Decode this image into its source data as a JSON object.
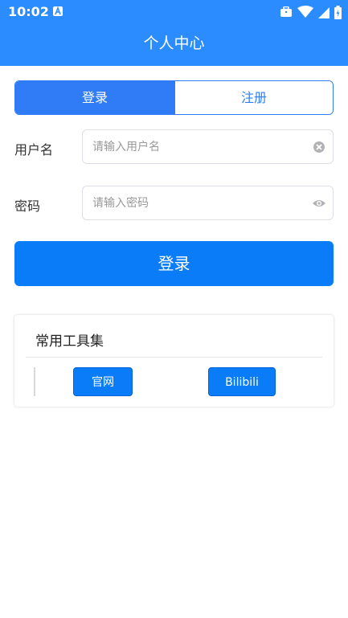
{
  "status_bar": {
    "time": "10:02"
  },
  "header": {
    "title": "个人中心"
  },
  "tabs": {
    "login": "登录",
    "register": "注册"
  },
  "form": {
    "username": {
      "label": "用户名",
      "placeholder": "请输入用户名"
    },
    "password": {
      "label": "密码",
      "placeholder": "请输入密码"
    },
    "submit": "登录"
  },
  "tools": {
    "title": "常用工具集",
    "buttons": [
      "官网",
      "Bilibili"
    ]
  },
  "colors": {
    "primary": "#2b8cff",
    "button": "#0a7cf7"
  }
}
